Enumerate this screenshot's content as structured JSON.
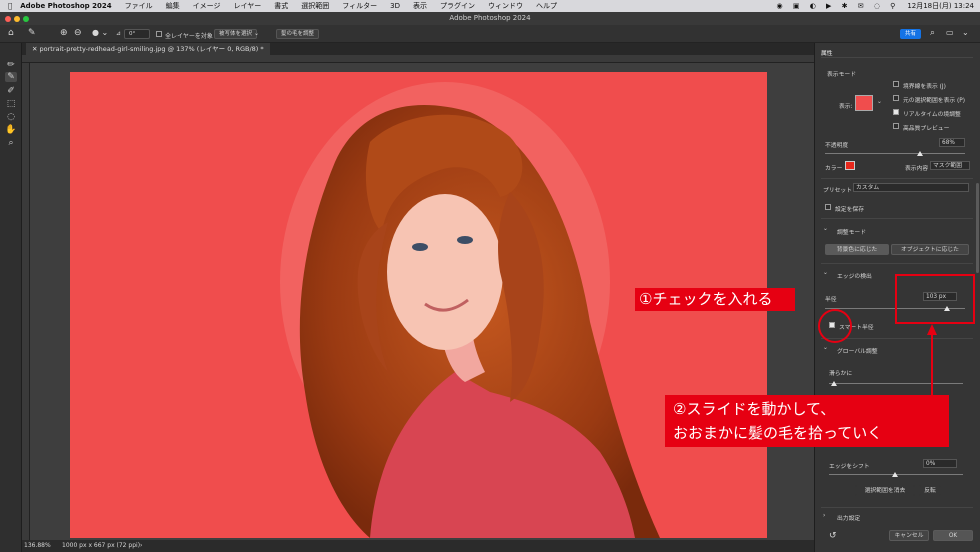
{
  "menubar": {
    "app": "Adobe Photoshop 2024",
    "items": [
      "ファイル",
      "編集",
      "イメージ",
      "レイヤー",
      "書式",
      "選択範囲",
      "フィルター",
      "3D",
      "表示",
      "プラグイン",
      "ウィンドウ",
      "ヘルプ"
    ],
    "clock": "12月18日(月) 13:24"
  },
  "window": {
    "title": "Adobe Photoshop 2024"
  },
  "optionsbar": {
    "angle": "0°",
    "sample_all_layers": "全レイヤーを対象",
    "select_subject": "被写体を選択",
    "refine_hair": "髪の毛を調整",
    "share": "共有"
  },
  "document": {
    "tab": "portrait-pretty-redhead-girl-smiling.jpg @ 137% (レイヤー 0, RGB/8) *",
    "zoom": "136.88%",
    "size": "1000 px x 667 px (72 ppi)"
  },
  "panel": {
    "title": "属性",
    "view_mode": "表示モード",
    "view_label": "表示:",
    "show_edge": "境界線を表示 (J)",
    "show_original": "元の選択範囲を表示 (P)",
    "realtime": "リアルタイムの境調整",
    "hq_preview": "高品質プレビュー",
    "opacity_label": "不透明度",
    "opacity_value": "68%",
    "opacity_fraction": 0.68,
    "color_label": "カラー",
    "color_hex": "#e8281c",
    "show_label": "表示内容",
    "show_value": "マスク範囲",
    "preset_label": "プリセット",
    "preset_value": "カスタム",
    "remember": "設定を保存",
    "adjust_mode": "調整モード",
    "mode_color": "背景色に応じた",
    "mode_object": "オブジェクトに応じた",
    "edge_detect": "エッジの検出",
    "radius_label": "半径",
    "radius_value": "103 px",
    "radius_fraction": 0.87,
    "smart_radius": "スマート半径",
    "global": "グローバル調整",
    "smooth_label": "滑らかに",
    "shift_edge_label": "エッジをシフト",
    "shift_edge_value": "0%",
    "clear_selection": "選択範囲を消去",
    "invert": "反転",
    "output": "出力設定",
    "cancel": "キャンセル",
    "ok": "OK"
  },
  "annotations": {
    "step1": "①チェックを入れる",
    "step2_line1": "②スライドを動かして、",
    "step2_line2": "おおまかに髪の毛を拾っていく"
  },
  "colors": {
    "annotation_red": "#e60012",
    "canvas_overlay": "#f04d4d",
    "panel_bg": "#353535"
  }
}
